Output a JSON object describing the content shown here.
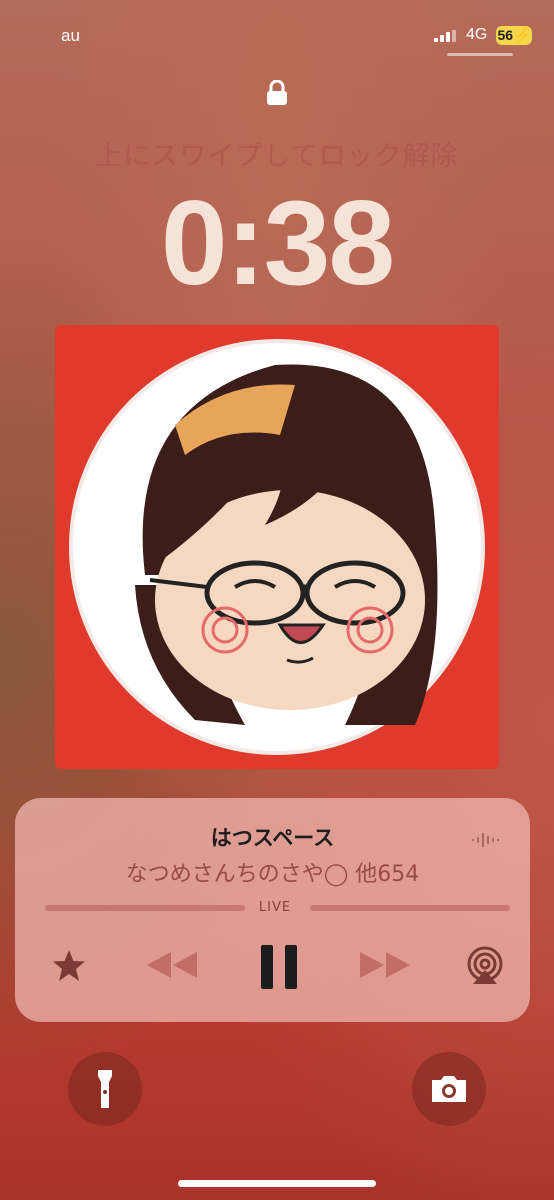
{
  "status_bar": {
    "carrier": "au",
    "network": "4G",
    "battery": "56"
  },
  "lock_screen": {
    "swipe_hint": "上にスワイプしてロック解除",
    "time": "0:38"
  },
  "now_playing": {
    "title": "はつスペース",
    "subtitle": "なつめさんちのさや◯ 他654",
    "progress_label": "LIVE",
    "progress": 1.0
  },
  "colors": {
    "artwork_bg": "#df3a2b",
    "battery": "#f4d64c"
  },
  "icons": [
    "lock-icon",
    "star-icon",
    "rewind-icon",
    "pause-icon",
    "fast-forward-icon",
    "airplay-icon",
    "flashlight-icon",
    "camera-icon"
  ]
}
